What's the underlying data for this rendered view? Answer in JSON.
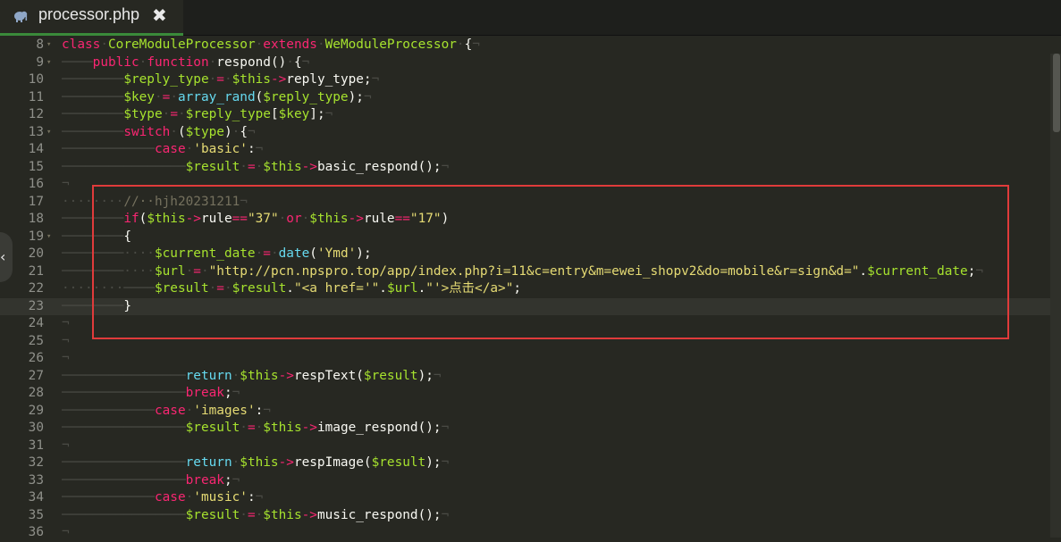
{
  "tab": {
    "title": "processor.php",
    "close_glyph": "✖",
    "icon": "php-elephant-icon"
  },
  "collapse_glyph": "‹",
  "lines": [
    {
      "n": "8",
      "fold": "▾",
      "tokens": [
        [
          "k",
          "class"
        ],
        [
          "g",
          "·"
        ],
        [
          "v",
          "CoreModuleProcessor"
        ],
        [
          "g",
          "·"
        ],
        [
          "k",
          "extends"
        ],
        [
          "g",
          "·"
        ],
        [
          "v",
          "WeModuleProcessor"
        ],
        [
          "g",
          "·"
        ],
        [
          "w",
          "{"
        ],
        [
          "g",
          "¬"
        ]
      ]
    },
    {
      "n": "9",
      "fold": "▾",
      "tokens": [
        [
          "g",
          "────"
        ],
        [
          "k",
          "public"
        ],
        [
          "g",
          "·"
        ],
        [
          "k",
          "function"
        ],
        [
          "g",
          "·"
        ],
        [
          "w",
          "respond()"
        ],
        [
          "g",
          "·"
        ],
        [
          "w",
          "{"
        ],
        [
          "g",
          "¬"
        ]
      ]
    },
    {
      "n": "10",
      "fold": "",
      "tokens": [
        [
          "g",
          "────────"
        ],
        [
          "v",
          "$reply_type"
        ],
        [
          "g",
          "·"
        ],
        [
          "k",
          "="
        ],
        [
          "g",
          "·"
        ],
        [
          "v",
          "$this"
        ],
        [
          "k",
          "->"
        ],
        [
          "w",
          "reply_type;"
        ],
        [
          "g",
          "¬"
        ]
      ]
    },
    {
      "n": "11",
      "fold": "",
      "tokens": [
        [
          "g",
          "────────"
        ],
        [
          "v",
          "$key"
        ],
        [
          "g",
          "·"
        ],
        [
          "k",
          "="
        ],
        [
          "g",
          "·"
        ],
        [
          "f",
          "array_rand"
        ],
        [
          "w",
          "("
        ],
        [
          "v",
          "$reply_type"
        ],
        [
          "w",
          ");"
        ],
        [
          "g",
          "¬"
        ]
      ]
    },
    {
      "n": "12",
      "fold": "",
      "tokens": [
        [
          "g",
          "────────"
        ],
        [
          "v",
          "$type"
        ],
        [
          "g",
          "·"
        ],
        [
          "k",
          "="
        ],
        [
          "g",
          "·"
        ],
        [
          "v",
          "$reply_type"
        ],
        [
          "w",
          "["
        ],
        [
          "v",
          "$key"
        ],
        [
          "w",
          "];"
        ],
        [
          "g",
          "¬"
        ]
      ]
    },
    {
      "n": "13",
      "fold": "▾",
      "tokens": [
        [
          "g",
          "────────"
        ],
        [
          "k",
          "switch"
        ],
        [
          "g",
          "·"
        ],
        [
          "w",
          "("
        ],
        [
          "v",
          "$type"
        ],
        [
          "w",
          ")"
        ],
        [
          "g",
          "·"
        ],
        [
          "w",
          "{"
        ],
        [
          "g",
          "¬"
        ]
      ]
    },
    {
      "n": "14",
      "fold": "",
      "tokens": [
        [
          "g",
          "────────────"
        ],
        [
          "k",
          "case"
        ],
        [
          "g",
          "·"
        ],
        [
          "s",
          "'basic'"
        ],
        [
          "w",
          ":"
        ],
        [
          "g",
          "¬"
        ]
      ]
    },
    {
      "n": "15",
      "fold": "",
      "tokens": [
        [
          "g",
          "────────────────"
        ],
        [
          "v",
          "$result"
        ],
        [
          "g",
          "·"
        ],
        [
          "k",
          "="
        ],
        [
          "g",
          "·"
        ],
        [
          "v",
          "$this"
        ],
        [
          "k",
          "->"
        ],
        [
          "w",
          "basic_respond();"
        ],
        [
          "g",
          "¬"
        ]
      ]
    },
    {
      "n": "16",
      "fold": "",
      "tokens": [
        [
          "g",
          "¬"
        ]
      ]
    },
    {
      "n": "17",
      "fold": "",
      "tokens": [
        [
          "g",
          "········"
        ],
        [
          "c",
          "//··hjh20231211"
        ],
        [
          "g",
          "¬"
        ]
      ]
    },
    {
      "n": "18",
      "fold": "",
      "tokens": [
        [
          "g",
          "────────"
        ],
        [
          "k",
          "if"
        ],
        [
          "w",
          "("
        ],
        [
          "v",
          "$this"
        ],
        [
          "k",
          "->"
        ],
        [
          "w",
          "rule"
        ],
        [
          "k",
          "=="
        ],
        [
          "s",
          "\"37\""
        ],
        [
          "g",
          "·"
        ],
        [
          "k",
          "or"
        ],
        [
          "g",
          "·"
        ],
        [
          "v",
          "$this"
        ],
        [
          "k",
          "->"
        ],
        [
          "w",
          "rule"
        ],
        [
          "k",
          "=="
        ],
        [
          "s",
          "\"17\""
        ],
        [
          "w",
          ")"
        ]
      ]
    },
    {
      "n": "19",
      "fold": "▾",
      "tokens": [
        [
          "g",
          "────────"
        ],
        [
          "w",
          "{"
        ]
      ]
    },
    {
      "n": "20",
      "fold": "",
      "tokens": [
        [
          "g",
          "────────····"
        ],
        [
          "v",
          "$current_date"
        ],
        [
          "g",
          "·"
        ],
        [
          "k",
          "="
        ],
        [
          "g",
          "·"
        ],
        [
          "f",
          "date"
        ],
        [
          "w",
          "("
        ],
        [
          "s",
          "'Ymd'"
        ],
        [
          "w",
          ");"
        ]
      ]
    },
    {
      "n": "21",
      "fold": "",
      "tokens": [
        [
          "g",
          "────────····"
        ],
        [
          "v",
          "$url"
        ],
        [
          "g",
          "·"
        ],
        [
          "k",
          "="
        ],
        [
          "g",
          "·"
        ],
        [
          "s",
          "\"http://pcn.npspro.top/app/index.php?i=11&c=entry&m=ewei_shopv2&do=mobile&r=sign&d=\""
        ],
        [
          "w",
          "."
        ],
        [
          "v",
          "$current_date"
        ],
        [
          "w",
          ";"
        ],
        [
          "g",
          "¬"
        ]
      ]
    },
    {
      "n": "22",
      "fold": "",
      "tokens": [
        [
          "g",
          "········────"
        ],
        [
          "v",
          "$result"
        ],
        [
          "g",
          "·"
        ],
        [
          "k",
          "="
        ],
        [
          "g",
          "·"
        ],
        [
          "v",
          "$result"
        ],
        [
          "w",
          "."
        ],
        [
          "s",
          "\"<a href='\""
        ],
        [
          "w",
          "."
        ],
        [
          "v",
          "$url"
        ],
        [
          "w",
          "."
        ],
        [
          "s",
          "\"'>点击</a>\""
        ],
        [
          "w",
          ";"
        ]
      ]
    },
    {
      "n": "23",
      "fold": "",
      "tokens": [
        [
          "g",
          "────────"
        ],
        [
          "w",
          "}"
        ]
      ]
    },
    {
      "n": "24",
      "fold": "",
      "tokens": [
        [
          "g",
          "¬"
        ]
      ]
    },
    {
      "n": "25",
      "fold": "",
      "tokens": [
        [
          "g",
          "¬"
        ]
      ]
    },
    {
      "n": "26",
      "fold": "",
      "tokens": [
        [
          "g",
          "¬"
        ]
      ]
    },
    {
      "n": "27",
      "fold": "",
      "tokens": [
        [
          "g",
          "────────────────"
        ],
        [
          "f",
          "return"
        ],
        [
          "g",
          "·"
        ],
        [
          "v",
          "$this"
        ],
        [
          "k",
          "->"
        ],
        [
          "w",
          "respText("
        ],
        [
          "v",
          "$result"
        ],
        [
          "w",
          ");"
        ],
        [
          "g",
          "¬"
        ]
      ]
    },
    {
      "n": "28",
      "fold": "",
      "tokens": [
        [
          "g",
          "────────────────"
        ],
        [
          "k",
          "break"
        ],
        [
          "w",
          ";"
        ],
        [
          "g",
          "¬"
        ]
      ]
    },
    {
      "n": "29",
      "fold": "",
      "tokens": [
        [
          "g",
          "────────────"
        ],
        [
          "k",
          "case"
        ],
        [
          "g",
          "·"
        ],
        [
          "s",
          "'images'"
        ],
        [
          "w",
          ":"
        ],
        [
          "g",
          "¬"
        ]
      ]
    },
    {
      "n": "30",
      "fold": "",
      "tokens": [
        [
          "g",
          "────────────────"
        ],
        [
          "v",
          "$result"
        ],
        [
          "g",
          "·"
        ],
        [
          "k",
          "="
        ],
        [
          "g",
          "·"
        ],
        [
          "v",
          "$this"
        ],
        [
          "k",
          "->"
        ],
        [
          "w",
          "image_respond();"
        ],
        [
          "g",
          "¬"
        ]
      ]
    },
    {
      "n": "31",
      "fold": "",
      "tokens": [
        [
          "g",
          "¬"
        ]
      ]
    },
    {
      "n": "32",
      "fold": "",
      "tokens": [
        [
          "g",
          "────────────────"
        ],
        [
          "f",
          "return"
        ],
        [
          "g",
          "·"
        ],
        [
          "v",
          "$this"
        ],
        [
          "k",
          "->"
        ],
        [
          "w",
          "respImage("
        ],
        [
          "v",
          "$result"
        ],
        [
          "w",
          ");"
        ],
        [
          "g",
          "¬"
        ]
      ]
    },
    {
      "n": "33",
      "fold": "",
      "tokens": [
        [
          "g",
          "────────────────"
        ],
        [
          "k",
          "break"
        ],
        [
          "w",
          ";"
        ],
        [
          "g",
          "¬"
        ]
      ]
    },
    {
      "n": "34",
      "fold": "",
      "tokens": [
        [
          "g",
          "────────────"
        ],
        [
          "k",
          "case"
        ],
        [
          "g",
          "·"
        ],
        [
          "s",
          "'music'"
        ],
        [
          "w",
          ":"
        ],
        [
          "g",
          "¬"
        ]
      ]
    },
    {
      "n": "35",
      "fold": "",
      "tokens": [
        [
          "g",
          "────────────────"
        ],
        [
          "v",
          "$result"
        ],
        [
          "g",
          "·"
        ],
        [
          "k",
          "="
        ],
        [
          "g",
          "·"
        ],
        [
          "v",
          "$this"
        ],
        [
          "k",
          "->"
        ],
        [
          "w",
          "music_respond();"
        ],
        [
          "g",
          "¬"
        ]
      ]
    },
    {
      "n": "36",
      "fold": "",
      "tokens": [
        [
          "g",
          "¬"
        ]
      ]
    }
  ],
  "current_line": "23",
  "theme": {
    "background": "#272822",
    "highlight_border": "#e03b3b",
    "tab_underline": "#3a8a3a"
  }
}
